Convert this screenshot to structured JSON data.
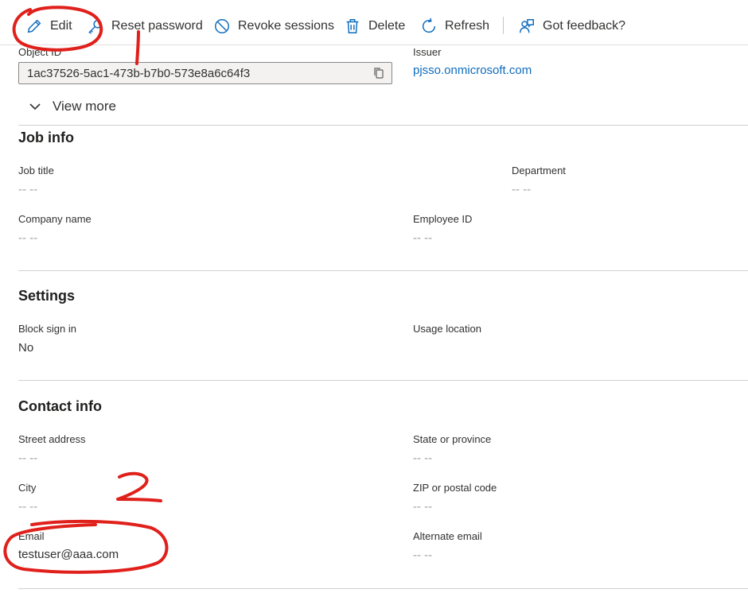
{
  "toolbar": {
    "edit": "Edit",
    "reset_password": "Reset password",
    "revoke_sessions": "Revoke sessions",
    "delete": "Delete",
    "refresh": "Refresh",
    "feedback": "Got feedback?"
  },
  "identity": {
    "object_id_label": "Object ID",
    "object_id_value": "1ac37526-5ac1-473b-b7b0-573e8a6c64f3",
    "issuer_label": "Issuer",
    "issuer_value": "pjsso.onmicrosoft.com",
    "view_more": "View more"
  },
  "job_info": {
    "title": "Job info",
    "job_title_label": "Job title",
    "job_title_value": "-- --",
    "department_label": "Department",
    "department_value": "-- --",
    "company_label": "Company name",
    "company_value": "-- --",
    "employee_id_label": "Employee ID",
    "employee_id_value": "-- --"
  },
  "settings": {
    "title": "Settings",
    "block_label": "Block sign in",
    "block_value": "No",
    "usage_label": "Usage location"
  },
  "contact": {
    "title": "Contact info",
    "street_label": "Street address",
    "street_value": "-- --",
    "state_label": "State or province",
    "state_value": "-- --",
    "city_label": "City",
    "city_value": "-- --",
    "zip_label": "ZIP or postal code",
    "zip_value": "-- --",
    "email_label": "Email",
    "email_value": "testuser@aaa.com",
    "alt_email_label": "Alternate email",
    "alt_email_value": "-- --"
  },
  "annotations": {
    "mark_1": "1",
    "mark_2": "2"
  },
  "colors": {
    "accent": "#0f6cbd",
    "annotation_red": "#e0201b"
  },
  "icons": [
    "pencil-icon",
    "key-icon",
    "prohibited-icon",
    "trash-icon",
    "refresh-icon",
    "feedback-icon",
    "copy-icon",
    "chevron-down-icon"
  ]
}
